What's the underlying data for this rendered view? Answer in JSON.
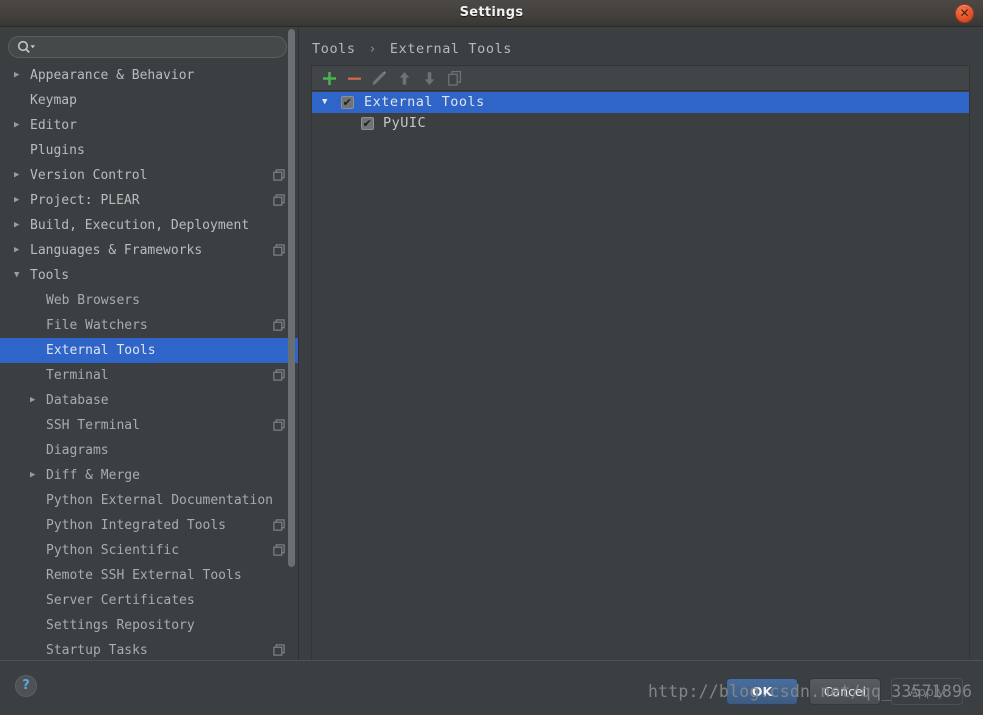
{
  "window": {
    "title": "Settings",
    "close_icon": "close-icon",
    "close_glyph": "✕"
  },
  "colors": {
    "window_bg": "#3c3f41",
    "titlebar_bg": "#43403d",
    "selection_blue": "#2f64c8",
    "close_button": "#e2522a",
    "add_green": "#4caf50",
    "remove_red": "#d9684a",
    "help_blue": "#56a8e0"
  },
  "search": {
    "placeholder": "",
    "value": "",
    "icon": "search-icon"
  },
  "sidebar": {
    "scrollbar": {
      "name": "sidebar-scrollbar-thumb"
    },
    "items": [
      {
        "label": "Appearance & Behavior",
        "level": "top",
        "arrow": "▶",
        "expanded": false,
        "scope_icon": false,
        "selected": false
      },
      {
        "label": "Keymap",
        "level": "top",
        "arrow": "",
        "expanded": false,
        "scope_icon": false,
        "selected": false
      },
      {
        "label": "Editor",
        "level": "top",
        "arrow": "▶",
        "expanded": false,
        "scope_icon": false,
        "selected": false
      },
      {
        "label": "Plugins",
        "level": "top",
        "arrow": "",
        "expanded": false,
        "scope_icon": false,
        "selected": false
      },
      {
        "label": "Version Control",
        "level": "top",
        "arrow": "▶",
        "expanded": false,
        "scope_icon": true,
        "selected": false
      },
      {
        "label": "Project: PLEAR",
        "level": "top",
        "arrow": "▶",
        "expanded": false,
        "scope_icon": true,
        "selected": false
      },
      {
        "label": "Build, Execution, Deployment",
        "level": "top",
        "arrow": "▶",
        "expanded": false,
        "scope_icon": false,
        "selected": false
      },
      {
        "label": "Languages & Frameworks",
        "level": "top",
        "arrow": "▶",
        "expanded": false,
        "scope_icon": true,
        "selected": false
      },
      {
        "label": "Tools",
        "level": "top",
        "arrow": "▼",
        "expanded": true,
        "scope_icon": false,
        "selected": false
      },
      {
        "label": "Web Browsers",
        "level": "child",
        "arrow": "",
        "expanded": false,
        "scope_icon": false,
        "selected": false
      },
      {
        "label": "File Watchers",
        "level": "child",
        "arrow": "",
        "expanded": false,
        "scope_icon": true,
        "selected": false
      },
      {
        "label": "External Tools",
        "level": "child",
        "arrow": "",
        "expanded": false,
        "scope_icon": false,
        "selected": true
      },
      {
        "label": "Terminal",
        "level": "child",
        "arrow": "",
        "expanded": false,
        "scope_icon": true,
        "selected": false
      },
      {
        "label": "Database",
        "level": "child",
        "arrow": "▶",
        "expanded": false,
        "scope_icon": false,
        "selected": false
      },
      {
        "label": "SSH Terminal",
        "level": "child",
        "arrow": "",
        "expanded": false,
        "scope_icon": true,
        "selected": false
      },
      {
        "label": "Diagrams",
        "level": "child",
        "arrow": "",
        "expanded": false,
        "scope_icon": false,
        "selected": false
      },
      {
        "label": "Diff & Merge",
        "level": "child",
        "arrow": "▶",
        "expanded": false,
        "scope_icon": false,
        "selected": false
      },
      {
        "label": "Python External Documentation",
        "level": "child",
        "arrow": "",
        "expanded": false,
        "scope_icon": false,
        "selected": false
      },
      {
        "label": "Python Integrated Tools",
        "level": "child",
        "arrow": "",
        "expanded": false,
        "scope_icon": true,
        "selected": false
      },
      {
        "label": "Python Scientific",
        "level": "child",
        "arrow": "",
        "expanded": false,
        "scope_icon": true,
        "selected": false
      },
      {
        "label": "Remote SSH External Tools",
        "level": "child",
        "arrow": "",
        "expanded": false,
        "scope_icon": false,
        "selected": false
      },
      {
        "label": "Server Certificates",
        "level": "child",
        "arrow": "",
        "expanded": false,
        "scope_icon": false,
        "selected": false
      },
      {
        "label": "Settings Repository",
        "level": "child",
        "arrow": "",
        "expanded": false,
        "scope_icon": false,
        "selected": false
      },
      {
        "label": "Startup Tasks",
        "level": "child",
        "arrow": "",
        "expanded": false,
        "scope_icon": true,
        "selected": false
      }
    ]
  },
  "main": {
    "breadcrumb": {
      "parent": "Tools",
      "separator": "›",
      "current": "External Tools"
    },
    "toolbar": [
      {
        "name": "add-tool-button",
        "icon": "plus-icon",
        "enabled": true,
        "tooltip": "Add"
      },
      {
        "name": "remove-tool-button",
        "icon": "minus-icon",
        "enabled": true,
        "tooltip": "Remove"
      },
      {
        "name": "edit-tool-button",
        "icon": "pencil-icon",
        "enabled": false,
        "tooltip": "Edit"
      },
      {
        "name": "move-up-button",
        "icon": "arrow-up-icon",
        "enabled": false,
        "tooltip": "Move Up"
      },
      {
        "name": "move-down-button",
        "icon": "arrow-down-icon",
        "enabled": false,
        "tooltip": "Move Down"
      },
      {
        "name": "copy-tool-button",
        "icon": "copy-pages-icon",
        "enabled": false,
        "tooltip": "Copy"
      }
    ],
    "tree": {
      "root": {
        "label": "External Tools",
        "checked": true,
        "expanded": true,
        "triangle": "▼",
        "selected": true,
        "tick": "✔"
      },
      "children": [
        {
          "label": "PyUIC",
          "checked": true,
          "selected": false,
          "tick": "✔"
        }
      ]
    }
  },
  "footer": {
    "help_icon": "question-mark-icon",
    "help_glyph": "?",
    "buttons": [
      {
        "name": "ok-button",
        "label": "OK",
        "enabled": true,
        "default": true
      },
      {
        "name": "cancel-button",
        "label": "Cancel",
        "enabled": true,
        "default": false
      },
      {
        "name": "apply-button",
        "label": "Apply",
        "enabled": false,
        "default": false
      }
    ]
  },
  "watermark": {
    "text": "http://blog.csdn.net/qq_33571896"
  }
}
